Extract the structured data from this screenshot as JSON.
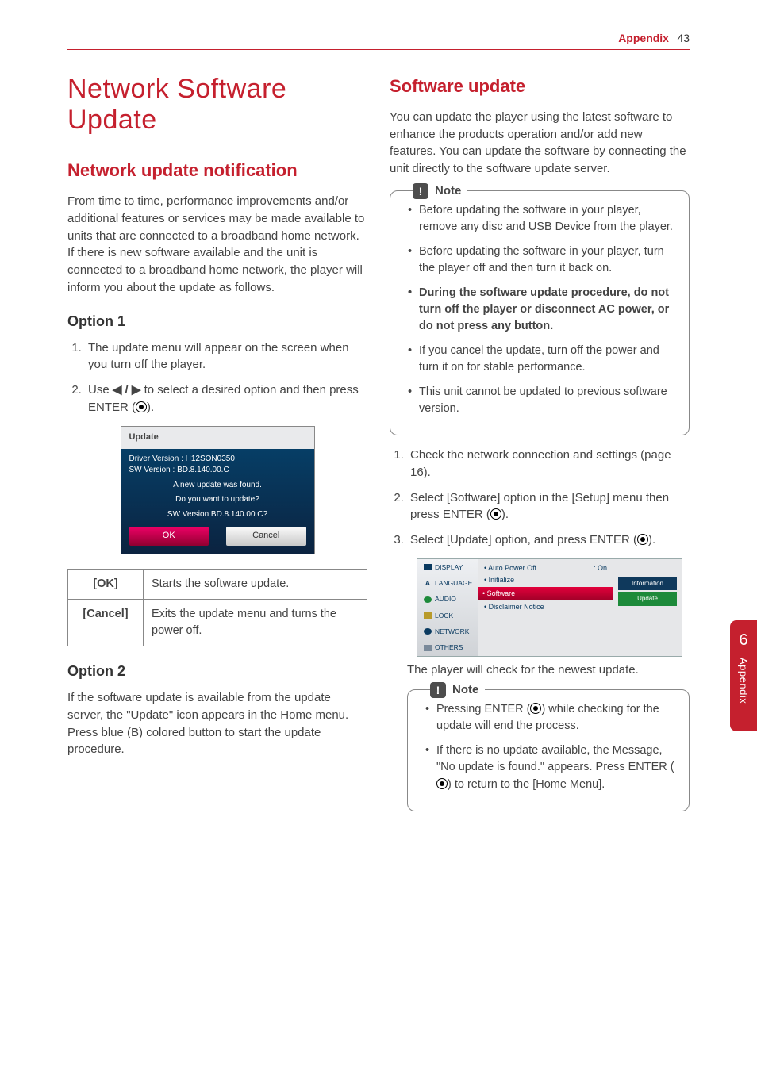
{
  "header": {
    "section": "Appendix",
    "page": "43"
  },
  "side_tab": {
    "number": "6",
    "label": "Appendix"
  },
  "left": {
    "h1": "Network Software Update",
    "h2": "Network update notification",
    "intro": "From time to time, performance improvements and/or additional features or services may be made available to units that are connected to a broadband home network. If there is new software available and the unit is connected to a broadband home network, the player will inform you about the update as follows.",
    "opt1_h": "Option 1",
    "opt1_li1": "The update menu will appear on the screen when you turn off the player.",
    "opt1_li2_a": "Use ",
    "opt1_li2_b": " to select a desired option and then press ENTER (",
    "opt1_li2_c": ").",
    "arrows": "◀ / ▶",
    "dialog": {
      "title": "Update",
      "l1": "Driver Version :  H12SON0350",
      "l2": "SW Version :   BD.8.140.00.C",
      "l3": "A new update was found.",
      "l4": "Do you want to update?",
      "l5": "SW Version  BD.8.140.00.C?",
      "ok": "OK",
      "cancel": "Cancel"
    },
    "tbl": {
      "k1": "[OK]",
      "v1": "Starts the software update.",
      "k2": "[Cancel]",
      "v2": "Exits the update menu and turns the power off."
    },
    "opt2_h": "Option 2",
    "opt2_p": "If the software update is available from the update server, the \"Update\" icon appears in the Home menu. Press blue (B) colored button to start the update procedure."
  },
  "right": {
    "h2": "Software update",
    "intro": "You can update the player using the latest software to enhance the products operation and/or add new features. You can update the software by connecting the unit directly to the software update server.",
    "note1_h": "Note",
    "note1": {
      "i1": "Before updating the software in your player, remove any disc and USB Device from the player.",
      "i2": "Before updating the software in your player, turn the player off and then turn it back on.",
      "i3": "During the software update procedure, do not turn off the player or disconnect AC power, or do not press any button.",
      "i4": "If you cancel the update, turn off the power and turn it on for stable performance.",
      "i5": "This unit cannot be updated to previous software version."
    },
    "ol": {
      "i1": "Check the network connection and settings (page 16).",
      "i2a": "Select [Software] option in the [Setup] menu then press ENTER (",
      "i2b": ").",
      "i3a": "Select [Update] option, and press ENTER (",
      "i3b": ")."
    },
    "setup": {
      "side": [
        "DISPLAY",
        "LANGUAGE",
        "AUDIO",
        "LOCK",
        "NETWORK",
        "OTHERS"
      ],
      "mid_top": "• Auto Power Off",
      "mid_top_v": ": On",
      "mid_items": [
        "• Initialize",
        "• Software",
        "• Disclaimer Notice"
      ],
      "r_btn1": "Information",
      "r_btn2": "Update"
    },
    "after_shot": "The player will check for the newest update.",
    "note2_h": "Note",
    "note2": {
      "i1a": "Pressing ENTER (",
      "i1b": ") while checking for the update will end the process.",
      "i2a": "If there is no update available, the Message, \"No update is found.\" appears. Press ENTER (",
      "i2b": ") to return to the [Home Menu]."
    }
  }
}
